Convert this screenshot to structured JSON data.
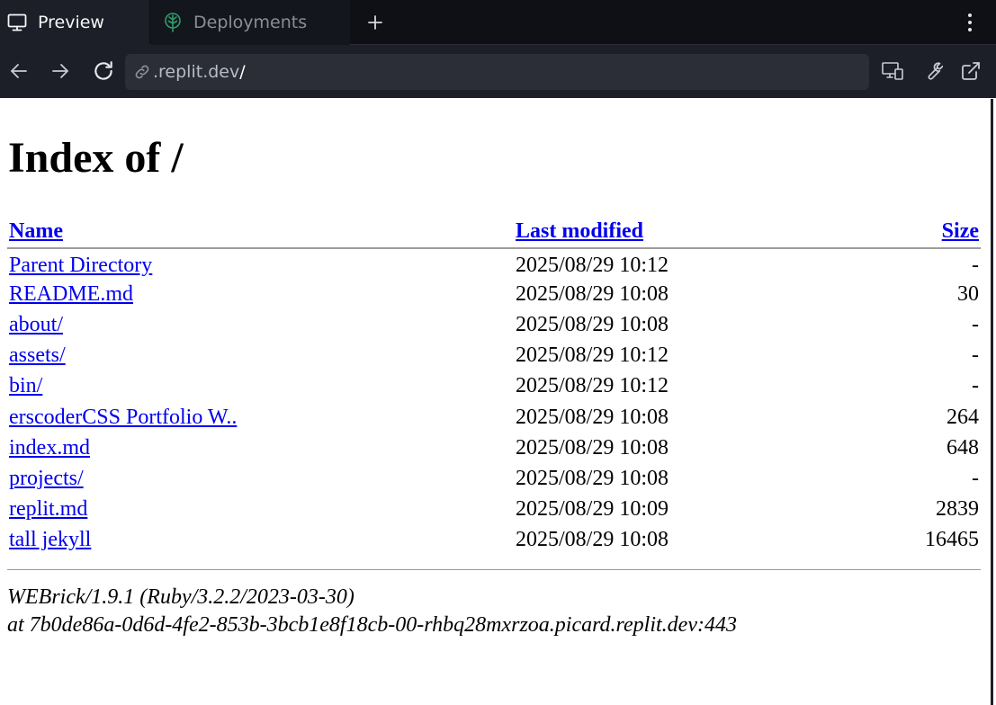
{
  "browser": {
    "tabs": [
      {
        "label": "Preview",
        "icon": "monitor-icon",
        "active": true
      },
      {
        "label": "Deployments",
        "icon": "deployments-icon",
        "active": false
      }
    ],
    "new_tab_icon": "plus-icon",
    "menu_icon": "kebab-menu-icon",
    "address": {
      "host": ".replit.dev",
      "path": "/"
    },
    "toolbar_icons": [
      "back-icon",
      "forward-icon",
      "reload-icon",
      "devices-icon",
      "devtools-wrench-icon",
      "open-external-icon"
    ]
  },
  "page": {
    "title": "Index of /",
    "columns": {
      "name": "Name",
      "modified": "Last modified",
      "size": "Size"
    },
    "rows": [
      {
        "name": "Parent Directory",
        "modified": "2025/08/29 10:12",
        "size": "-"
      },
      {
        "name": "README.md",
        "modified": "2025/08/29 10:08",
        "size": "30"
      },
      {
        "name": "about/",
        "modified": "2025/08/29 10:08",
        "size": "-"
      },
      {
        "name": "assets/",
        "modified": "2025/08/29 10:12",
        "size": "-"
      },
      {
        "name": "bin/",
        "modified": "2025/08/29 10:12",
        "size": "-"
      },
      {
        "name": "erscoderCSS Portfolio W..",
        "modified": "2025/08/29 10:08",
        "size": "264"
      },
      {
        "name": "index.md",
        "modified": "2025/08/29 10:08",
        "size": "648"
      },
      {
        "name": "projects/",
        "modified": "2025/08/29 10:08",
        "size": "-"
      },
      {
        "name": "replit.md",
        "modified": "2025/08/29 10:09",
        "size": "2839"
      },
      {
        "name": "tall jekyll",
        "modified": "2025/08/29 10:08",
        "size": "16465"
      }
    ],
    "server_line1": "WEBrick/1.9.1 (Ruby/3.2.2/2023-03-30)",
    "server_line2": "at 7b0de86a-0d6d-4fe2-853b-3bcb1e8f18cb-00-rhbq28mxrzoa.picard.replit.dev:443"
  },
  "colors": {
    "chrome_dark": "#0e1016",
    "chrome_panel": "#1c1f27",
    "url_field": "#2b2e37",
    "link": "#0000ee",
    "deploy_icon_green": "#2e9d6b"
  }
}
